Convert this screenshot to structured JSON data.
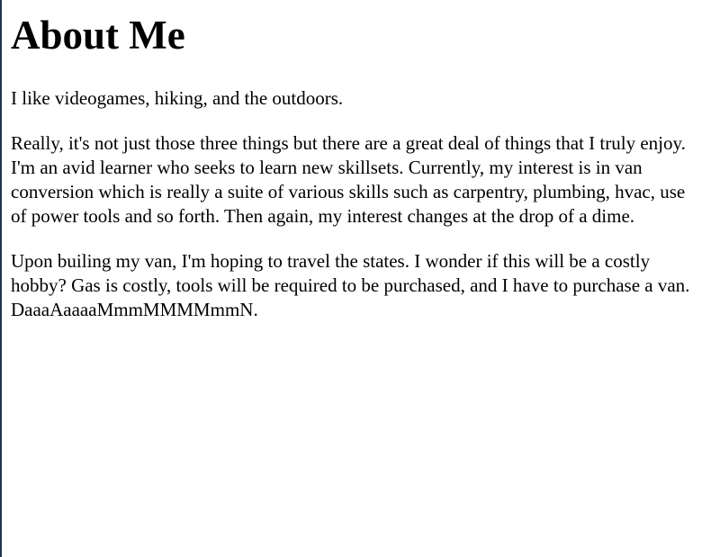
{
  "page": {
    "heading": "About Me",
    "paragraphs": [
      "I like videogames, hiking, and the outdoors.",
      "Really, it's not just those three things but there are a great deal of things that I truly enjoy. I'm an avid learner who seeks to learn new skillsets. Currently, my interest is in van conversion which is really a suite of various skills such as carpentry, plumbing, hvac, use of power tools and so forth. Then again, my interest changes at the drop of a dime.",
      "Upon builing my van, I'm hoping to travel the states. I wonder if this will be a costly hobby? Gas is costly, tools will be required to be purchased, and I have to purchase a van. DaaaAaaaaMmmMMMMmmN."
    ]
  },
  "colors": {
    "background": "#ffffff",
    "text": "#000000",
    "left_border": "#1f3550"
  }
}
